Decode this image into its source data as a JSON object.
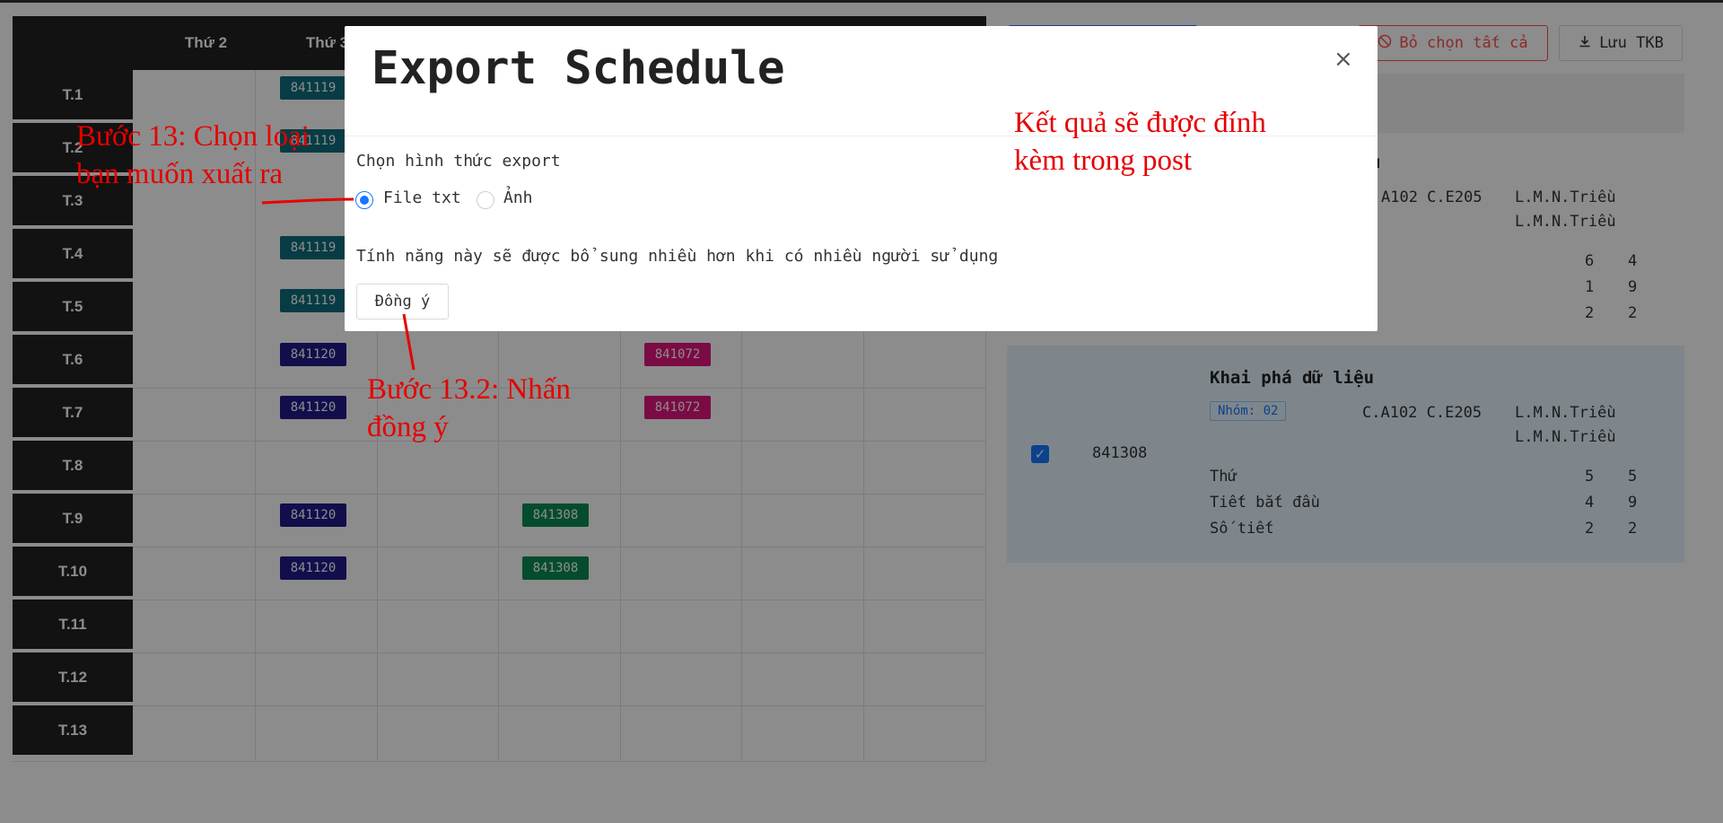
{
  "schedule": {
    "days": [
      "Thứ 2",
      "Thứ 3"
    ],
    "periods": [
      "T.1",
      "T.2",
      "T.3",
      "T.4",
      "T.5",
      "T.6",
      "T.7",
      "T.8",
      "T.9",
      "T.10",
      "T.11",
      "T.12",
      "T.13"
    ],
    "chips": [
      {
        "code": "841119",
        "color": "teal"
      },
      {
        "code": "841119",
        "color": "teal"
      },
      {
        "code": "841119",
        "color": "teal"
      },
      {
        "code": "841119",
        "color": "teal"
      },
      {
        "code": "841120",
        "color": "navy"
      },
      {
        "code": "841072",
        "color": "magenta"
      },
      {
        "code": "841120",
        "color": "navy"
      },
      {
        "code": "841072",
        "color": "magenta"
      },
      {
        "code": "841120",
        "color": "navy"
      },
      {
        "code": "841308",
        "color": "green"
      },
      {
        "code": "841120",
        "color": "navy"
      },
      {
        "code": "841308",
        "color": "green"
      }
    ]
  },
  "toolbar": {
    "deselect_label": "Bỏ chọn tất cả",
    "save_label": "Lưu TKB"
  },
  "course1": {
    "title_tail": "u",
    "rooms": "A102 C.E205",
    "teacher1": "L.M.N.Triều",
    "teacher2": "L.M.N.Triều",
    "v_thu_1": "6",
    "v_thu_2": "4",
    "v_tiet_1": "1",
    "v_tiet_2": "9",
    "v_so_1": "2",
    "v_so_2": "2"
  },
  "course2": {
    "title": "Khai phá dữ liệu",
    "nhom": "Nhóm: 02",
    "rooms": "C.A102 C.E205",
    "teacher1": "L.M.N.Triều",
    "teacher2": "L.M.N.Triều",
    "code": "841308",
    "thu_label": "Thứ",
    "tiet_label": "Tiết bắt đầu",
    "so_label": "Số tiết",
    "v_thu_1": "5",
    "v_thu_2": "5",
    "v_tiet_1": "4",
    "v_tiet_2": "9",
    "v_so_1": "2",
    "v_so_2": "2"
  },
  "modal": {
    "title": "Export Schedule",
    "label": "Chọn hình thức export",
    "option_txt": "File txt",
    "option_image": "Ảnh",
    "selected": "File txt",
    "note": "Tính năng này sẽ được bổ sung nhiều hơn khi có nhiều người sử dụng",
    "ok_label": "Đồng ý",
    "close_symbol": "×"
  },
  "annotations": {
    "step13": "Bước 13: Chọn loại bạn muốn xuất ra",
    "step13_2": "Bước 13.2: Nhấn đồng ý",
    "result": "Kết quả sẽ được đính kèm trong post"
  },
  "colors": {
    "primary": "#1677ff",
    "danger": "#ff4d4f",
    "annotation": "#e60000",
    "chip_teal": "#0e6e7c",
    "chip_navy": "#211a8a",
    "chip_magenta": "#e0157c",
    "chip_green": "#0a8a54"
  },
  "icons": {
    "deselect": "ban-icon",
    "save": "download-icon",
    "close": "close-icon",
    "checkbox": "check-icon"
  }
}
